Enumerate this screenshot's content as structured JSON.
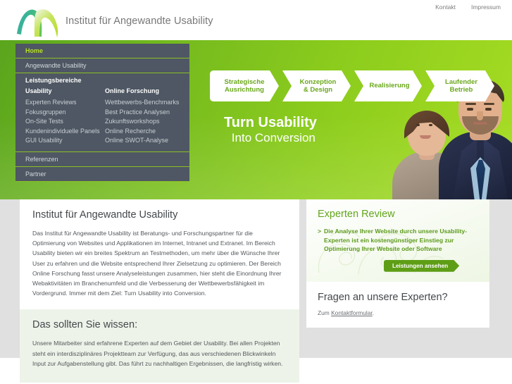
{
  "header": {
    "logo_icon": "wave-swoosh-logo",
    "logo_text": "Institut für Angewandte Usability",
    "meta_nav": [
      {
        "label": "Kontakt"
      },
      {
        "label": "Impressum"
      }
    ]
  },
  "sidebar": {
    "home": "Home",
    "angewandte_usability": "Angewandte Usability",
    "leistungsbereiche": "Leistungsbereiche",
    "columns": [
      {
        "heading": "Usability",
        "items": [
          "Experten Reviews",
          "Fokusgruppen",
          "On-Site Tests",
          "Kundenindividuelle Panels",
          "GUI Usability"
        ]
      },
      {
        "heading": "Online Forschung",
        "items": [
          "Wettbewerbs-Benchmarks",
          "Best Practice Analysen",
          "Zukunftsworkshops",
          "Online Recherche",
          "Online SWOT-Analyse"
        ]
      }
    ],
    "referenzen": "Referenzen",
    "partner": "Partner"
  },
  "hero": {
    "steps": [
      {
        "line1": "Strategische",
        "line2": "Ausrichtung"
      },
      {
        "line1": "Konzeption",
        "line2": "& Design"
      },
      {
        "line1": "Realisierung",
        "line2": ""
      },
      {
        "line1": "Laufender",
        "line2": "Betrieb"
      }
    ],
    "claim_line1": "Turn Usability",
    "claim_line2": "Into Conversion",
    "photo_alt": "business-people-photo"
  },
  "main": {
    "intro": {
      "title": "Institut für Angewandte Usability",
      "body": "Das Institut für Angewandte Usability ist Beratungs- und Forschungspartner für die Optimierung von Websites und Applikationen im Internet, Intranet und Extranet. Im Bereich Usability bieten wir ein breites Spektrum an Testmethoden, um mehr über die Wünsche Ihrer User zu erfahren und die Website entsprechend Ihrer Zielsetzung zu optimieren. Der Bereich Online Forschung fasst unsere Analyseleistungen zusammen, hier steht die Einordnung Ihrer Webaktivitäten im Branchenumfeld und die Verbesserung der Wettbewerbsfähigkeit im Vordergrund. Immer mit dem Ziel: Turn Usability into Conversion."
    },
    "know": {
      "title": "Das sollten Sie wissen:",
      "body": "Unsere Mitarbeiter sind erfahrene Experten auf dem Gebiet der Usability. Bei allen Projekten steht ein interdisziplinäres Projektteam zur Verfügung, das aus verschiedenen Blickwinkeln Input zur Aufgabenstellung gibt. Das führt zu nachhaltigen Ergebnissen, die langfristig wirken."
    }
  },
  "aside": {
    "review": {
      "title": "Experten Review",
      "bullet_marker": ">",
      "text": "Die Analyse Ihrer Website durch unsere Usability-Experten ist ein kostengünstiger Einstieg zur Optimierung Ihrer Website oder Software",
      "cta_label": "Leistungen ansehen"
    },
    "contact": {
      "title": "Fragen an unsere Experten?",
      "prefix": "Zum ",
      "link_label": "Kontaktformular",
      "suffix": "."
    }
  },
  "colors": {
    "green_primary": "#76bb1e",
    "green_dark": "#5aa51d",
    "green_accent": "#8cc026",
    "green_text": "#63a51d",
    "slate": "#4e5763",
    "active_nav": "#b7e223",
    "tint_panel": "#edf3e9",
    "backdrop": "#e0e0e0"
  }
}
